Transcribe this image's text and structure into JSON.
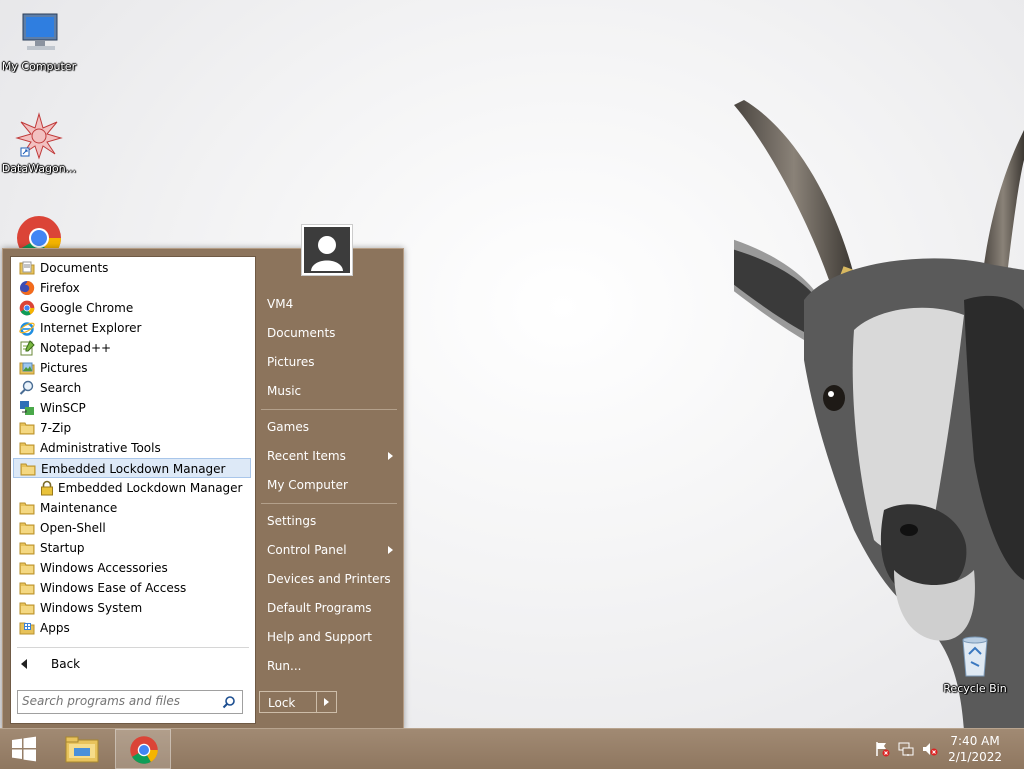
{
  "desktop": {
    "icons": [
      {
        "label": "My Computer"
      },
      {
        "label": "DataWagon..."
      },
      {
        "label": ""
      }
    ],
    "recycle_bin": {
      "label": "Recycle Bin"
    }
  },
  "start_menu": {
    "programs": [
      {
        "label": "Documents",
        "icon": "folder-doc-icon"
      },
      {
        "label": "Firefox",
        "icon": "firefox-icon"
      },
      {
        "label": "Google Chrome",
        "icon": "chrome-icon"
      },
      {
        "label": "Internet Explorer",
        "icon": "ie-icon"
      },
      {
        "label": "Notepad++",
        "icon": "notepad-icon"
      },
      {
        "label": "Pictures",
        "icon": "folder-pictures-icon"
      },
      {
        "label": "Search",
        "icon": "search-icon"
      },
      {
        "label": "WinSCP",
        "icon": "winscp-icon"
      },
      {
        "label": "7-Zip",
        "icon": "folder-icon"
      },
      {
        "label": "Administrative Tools",
        "icon": "folder-icon"
      },
      {
        "label": "Embedded Lockdown Manager",
        "icon": "folder-icon"
      },
      {
        "label": "Embedded Lockdown Manager",
        "icon": "lock-icon"
      },
      {
        "label": "Maintenance",
        "icon": "folder-icon"
      },
      {
        "label": "Open-Shell",
        "icon": "folder-icon"
      },
      {
        "label": "Startup",
        "icon": "folder-icon"
      },
      {
        "label": "Windows Accessories",
        "icon": "folder-icon"
      },
      {
        "label": "Windows Ease of Access",
        "icon": "folder-icon"
      },
      {
        "label": "Windows System",
        "icon": "folder-icon"
      },
      {
        "label": "Apps",
        "icon": "apps-icon"
      }
    ],
    "back_label": "Back",
    "search_placeholder": "Search programs and files",
    "right_items": [
      {
        "label": "VM4"
      },
      {
        "label": "Documents"
      },
      {
        "label": "Pictures"
      },
      {
        "label": "Music"
      },
      {
        "label": "Games"
      },
      {
        "label": "Recent Items"
      },
      {
        "label": "My Computer"
      },
      {
        "label": "Settings"
      },
      {
        "label": "Control Panel"
      },
      {
        "label": "Devices and Printers"
      },
      {
        "label": "Default Programs"
      },
      {
        "label": "Help and Support"
      },
      {
        "label": "Run..."
      }
    ],
    "lock_label": "Lock"
  },
  "taskbar": {
    "time": "7:40 AM",
    "date": "2/1/2022"
  },
  "colors": {
    "menu_bg": "#8c745c",
    "taskbar_bg": "#9a8169",
    "highlight": "#dde9f7"
  }
}
